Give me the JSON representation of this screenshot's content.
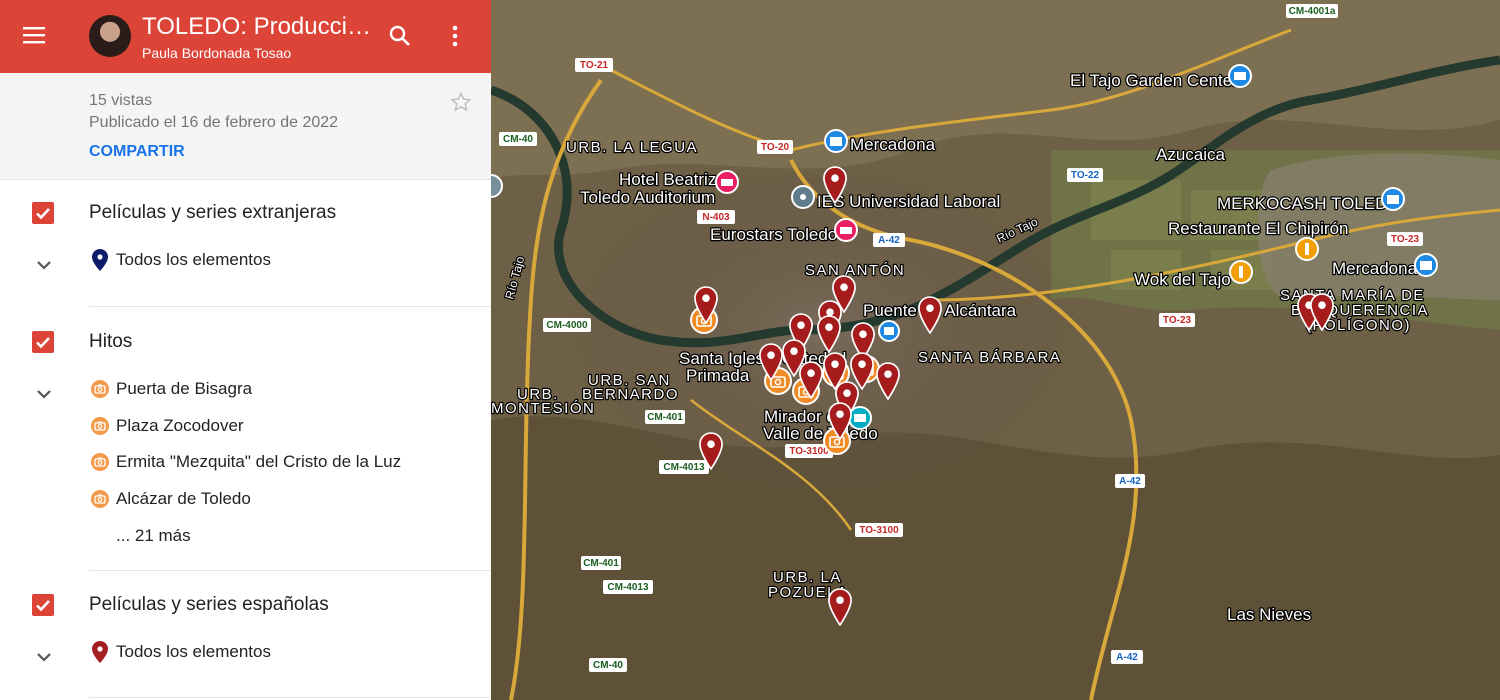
{
  "header": {
    "title": "TOLEDO: Producciones audiovisuales",
    "author": "Paula Bordonada Tosao",
    "menu_icon": "menu-icon",
    "search_icon": "search-icon",
    "more_icon": "more-vert-icon",
    "color": "#db4437"
  },
  "meta": {
    "views": "15 vistas",
    "published": "Publicado el 16 de febrero de 2022",
    "share": "COMPARTIR",
    "star_icon": "star-outline-icon"
  },
  "layers": [
    {
      "title": "Películas y series extranjeras",
      "checked": true,
      "items": [
        "Todos los elementos"
      ]
    },
    {
      "title": "Hitos",
      "checked": true,
      "items": [
        "Puerta de Bisagra",
        "Plaza Zocodover",
        "Ermita \"Mezquita\" del Cristo de la Luz",
        "Alcázar de Toledo"
      ],
      "more": "... 21 más"
    },
    {
      "title": "Películas y series españolas",
      "checked": true,
      "items": [
        "Todos los elementos"
      ]
    }
  ],
  "map": {
    "places": [
      {
        "id": "tajo-garden",
        "text": "El Tajo Garden Center"
      },
      {
        "id": "mercadona-1",
        "text": "Mercadona"
      },
      {
        "id": "urb-legua",
        "text": "URB. LA LEGUA"
      },
      {
        "id": "azucaica",
        "text": "Azucaica"
      },
      {
        "id": "hotel-1",
        "text": "Hotel Beatriz"
      },
      {
        "id": "hotel-2",
        "text": "Toledo Auditorium"
      },
      {
        "id": "universidad",
        "text": "IES Universidad Laboral"
      },
      {
        "id": "merkocash",
        "text": "MERKOCASH TOLEDO"
      },
      {
        "id": "chipiron",
        "text": "Restaurante El Chipirón"
      },
      {
        "id": "eurostars",
        "text": "Eurostars Toledo"
      },
      {
        "id": "san-anton",
        "text": "SAN ANTÓN"
      },
      {
        "id": "wok",
        "text": "Wok del Tajo"
      },
      {
        "id": "mercadona-2",
        "text": "Mercadona"
      },
      {
        "id": "santa-maria-1",
        "text": "SANTA MARÍA DE"
      },
      {
        "id": "santa-maria-2",
        "text": "BENQUERENCIA"
      },
      {
        "id": "santa-maria-3",
        "text": "(POLÍGONO)"
      },
      {
        "id": "puente",
        "text": "Puente de Alcántara"
      },
      {
        "id": "santa-barbara",
        "text": "SANTA BÁRBARA"
      },
      {
        "id": "santa-iglesia-1",
        "text": "Santa Iglesia Catedral"
      },
      {
        "id": "santa-iglesia-2",
        "text": "Primada"
      },
      {
        "id": "san-bernardo-1",
        "text": "URB. SAN"
      },
      {
        "id": "san-bernardo-2",
        "text": "BERNARDO"
      },
      {
        "id": "montesion-1",
        "text": "URB."
      },
      {
        "id": "montesion-2",
        "text": "MONTESIÓN"
      },
      {
        "id": "mirador-1",
        "text": "Mirador del"
      },
      {
        "id": "mirador-2",
        "text": "Valle de Toledo"
      },
      {
        "id": "pozuela-1",
        "text": "URB. LA"
      },
      {
        "id": "pozuela-2",
        "text": "POZUELA"
      },
      {
        "id": "las-nieves",
        "text": "Las Nieves"
      },
      {
        "id": "rio-tajo-1",
        "text": "Río Tajo"
      },
      {
        "id": "rio-tajo-2",
        "text": "Río Tajo"
      }
    ],
    "roads": [
      "CM-4001a",
      "TO-21",
      "CM-40",
      "TO-20",
      "TO-22",
      "N-403",
      "A-42",
      "TO-23",
      "TO-23",
      "CM-4000",
      "CM-401",
      "CM-4013",
      "TO-3100",
      "A-42",
      "TO-3100",
      "CM-401",
      "CM-4013",
      "CM-40",
      "A-42"
    ]
  }
}
